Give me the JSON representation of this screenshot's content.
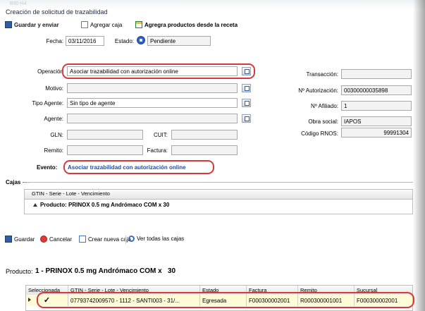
{
  "window": {
    "ghost_title": "B90-H4",
    "title": "Creación de solicitud de trazabilidad"
  },
  "toolbar": {
    "save_send": "Guardar y enviar",
    "add_box": "Agregar caja",
    "add_products": "Agregra productos desde la receta"
  },
  "form": {
    "fecha_label": "Fecha:",
    "fecha_value": "03/11/2016",
    "estado_label": "Estado:",
    "estado_value": "Pendiente",
    "operacion_label": "Operación",
    "operacion_value": "Asociar trazabilidad con autorización online",
    "motivo_label": "Motivo:",
    "motivo_value": "",
    "tipo_agente_label": "Tipo Agente:",
    "tipo_agente_value": "Sin tipo de agente",
    "agente_label": "Agente:",
    "agente_value": "",
    "gln_label": "GLN:",
    "gln_value": "",
    "cuit_label": "CUIT:",
    "cuit_value": "",
    "remito_label": "Remito:",
    "remito_value": "",
    "factura_label": "Factura:",
    "factura_value": "",
    "evento_label": "Evento:",
    "evento_value": "Asociar trazabilidad con autorización online"
  },
  "right_form": {
    "transaccion_label": "Transacción:",
    "transaccion_value": "",
    "autorizacion_label": "Nº Autorización:",
    "autorizacion_value": "00300000035898",
    "afiliado_label": "Nº Afiliado:",
    "afiliado_value": "1",
    "obra_label": "Obra social:",
    "obra_value": "IAPOS",
    "rnos_label": "Código RNOS:",
    "rnos_value": "99991304"
  },
  "cajas": {
    "title": "Cajas",
    "grid_header": "GTIN - Serie - Lote - Vencimiento",
    "group_row": "Producto: PRINOX 0.5 mg Andrómaco COM x  30"
  },
  "bottom_toolbar": {
    "save": "Guardar",
    "cancel": "Cancelar",
    "new_box": "Crear nueva caja",
    "view_all": "Ver todas las cajas"
  },
  "product_section": {
    "label": "Producto:",
    "value": "1 - PRINOX 0.5 mg Andrómaco COM x   30"
  },
  "table": {
    "headers": [
      "Seleccionada",
      "GTIN - Serie - Lote - Vencimiento",
      "Estado",
      "Factura",
      "Remito",
      "Sucursal"
    ],
    "rows": [
      {
        "check": "✓",
        "gtin": "07793742009570 - 1112 - SANTI003 - 31/...",
        "estado": "Egresada",
        "factura": "F000300002001",
        "remito": "R000300001001",
        "sucursal": "F000300002001"
      }
    ]
  },
  "colors": {
    "accent_red": "#d9383a",
    "link_blue": "#1f4e9c",
    "row_highlight": "#fffbd6"
  }
}
